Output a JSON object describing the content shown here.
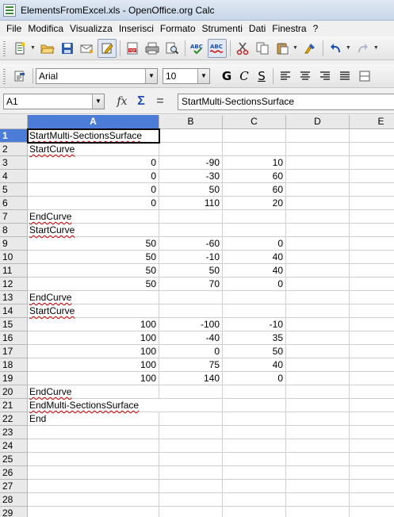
{
  "window": {
    "title": "ElementsFromExcel.xls - OpenOffice.org Calc"
  },
  "menu": [
    "File",
    "Modifica",
    "Visualizza",
    "Inserisci",
    "Formato",
    "Strumenti",
    "Dati",
    "Finestra",
    "?"
  ],
  "standard_toolbar": {
    "icons": [
      "new-document-icon",
      "open-folder-icon",
      "save-icon",
      "email-icon",
      "edit-mode-icon",
      "export-pdf-icon",
      "print-icon",
      "page-preview-icon",
      "spellcheck-icon",
      "autospellcheck-icon",
      "cut-icon",
      "copy-icon",
      "paste-icon",
      "format-paintbrush-icon",
      "undo-icon",
      "redo-icon"
    ]
  },
  "formatting_toolbar": {
    "font_name": "Arial",
    "font_size": "10",
    "bold_label": "G",
    "italic_label": "C",
    "underline_label": "S"
  },
  "formula_bar": {
    "name_box": "A1",
    "function_wizard": "fx",
    "sum": "Σ",
    "equals": "=",
    "content": "StartMulti-SectionsSurface"
  },
  "sheet": {
    "columns": [
      "A",
      "B",
      "C",
      "D",
      "E"
    ],
    "selected_column": "A",
    "selected_row": 1,
    "active_cell": "A1",
    "rows": [
      {
        "n": "1",
        "a": "StartMulti-SectionsSurface",
        "b": "",
        "c": ""
      },
      {
        "n": "2",
        "a": "StartCurve",
        "b": "",
        "c": ""
      },
      {
        "n": "3",
        "a": "0",
        "b": "-90",
        "c": "10"
      },
      {
        "n": "4",
        "a": "0",
        "b": "-30",
        "c": "60"
      },
      {
        "n": "5",
        "a": "0",
        "b": "50",
        "c": "60"
      },
      {
        "n": "6",
        "a": "0",
        "b": "110",
        "c": "20"
      },
      {
        "n": "7",
        "a": "EndCurve",
        "b": "",
        "c": ""
      },
      {
        "n": "8",
        "a": "StartCurve",
        "b": "",
        "c": ""
      },
      {
        "n": "9",
        "a": "50",
        "b": "-60",
        "c": "0"
      },
      {
        "n": "10",
        "a": "50",
        "b": "-10",
        "c": "40"
      },
      {
        "n": "11",
        "a": "50",
        "b": "50",
        "c": "40"
      },
      {
        "n": "12",
        "a": "50",
        "b": "70",
        "c": "0"
      },
      {
        "n": "13",
        "a": "EndCurve",
        "b": "",
        "c": ""
      },
      {
        "n": "14",
        "a": "StartCurve",
        "b": "",
        "c": ""
      },
      {
        "n": "15",
        "a": "100",
        "b": "-100",
        "c": "-10"
      },
      {
        "n": "16",
        "a": "100",
        "b": "-40",
        "c": "35"
      },
      {
        "n": "17",
        "a": "100",
        "b": "0",
        "c": "50"
      },
      {
        "n": "18",
        "a": "100",
        "b": "75",
        "c": "40"
      },
      {
        "n": "19",
        "a": "100",
        "b": "140",
        "c": "0"
      },
      {
        "n": "20",
        "a": "EndCurve",
        "b": "",
        "c": ""
      },
      {
        "n": "21",
        "a": "EndMulti-SectionsSurface",
        "b": "",
        "c": ""
      },
      {
        "n": "22",
        "a": "End",
        "b": "",
        "c": ""
      },
      {
        "n": "23",
        "a": "",
        "b": "",
        "c": ""
      },
      {
        "n": "24",
        "a": "",
        "b": "",
        "c": ""
      },
      {
        "n": "25",
        "a": "",
        "b": "",
        "c": ""
      },
      {
        "n": "26",
        "a": "",
        "b": "",
        "c": ""
      },
      {
        "n": "27",
        "a": "",
        "b": "",
        "c": ""
      },
      {
        "n": "28",
        "a": "",
        "b": "",
        "c": ""
      },
      {
        "n": "29",
        "a": "",
        "b": "",
        "c": ""
      }
    ]
  },
  "colors": {
    "selection": "#4b7dd8",
    "spell_underline": "#d00000"
  }
}
